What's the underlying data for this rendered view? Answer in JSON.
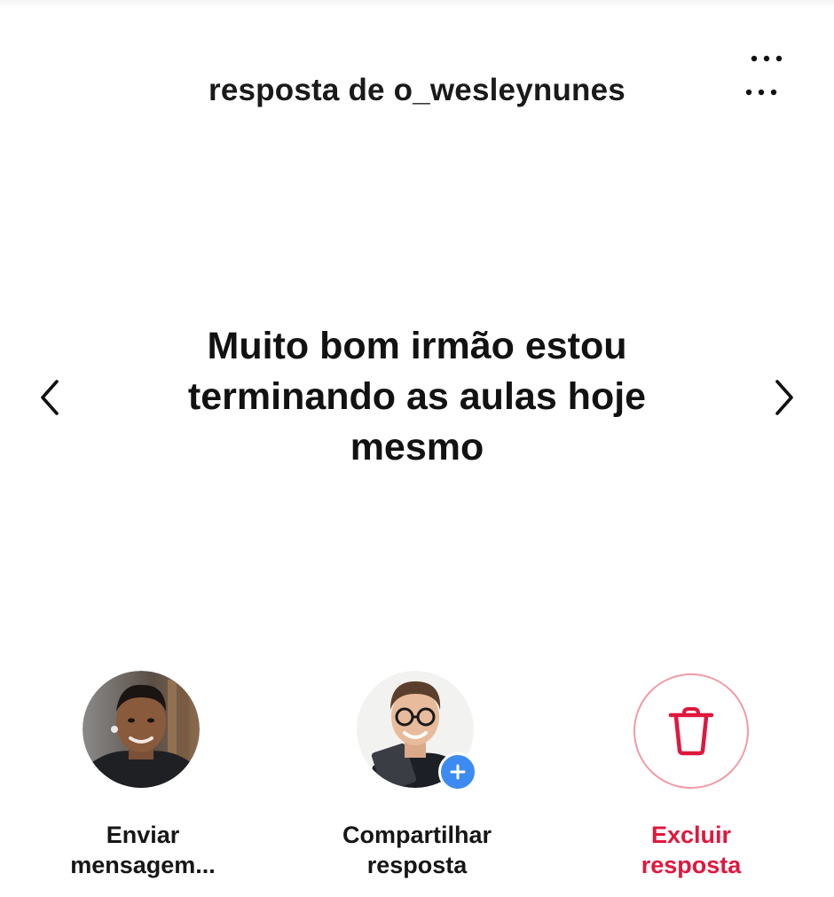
{
  "header": {
    "title": "resposta de o_wesleynunes",
    "more_icon": "more-horizontal-icon"
  },
  "reply": {
    "text": "Muito bom irmão estou terminando as aulas hoje mesmo"
  },
  "navigation": {
    "prev_icon": "chevron-left-icon",
    "next_icon": "chevron-right-icon"
  },
  "actions": [
    {
      "line1": "Enviar",
      "line2": "mensagem..."
    },
    {
      "line1": "Compartilhar",
      "line2": "resposta",
      "badge_icon": "plus-icon"
    },
    {
      "line1": "Excluir",
      "line2": "resposta",
      "icon": "trash-icon"
    }
  ],
  "colors": {
    "danger": "#e0173d",
    "danger_border": "#f19aa6",
    "badge_blue": "#3d8bf0",
    "text": "#121212"
  }
}
